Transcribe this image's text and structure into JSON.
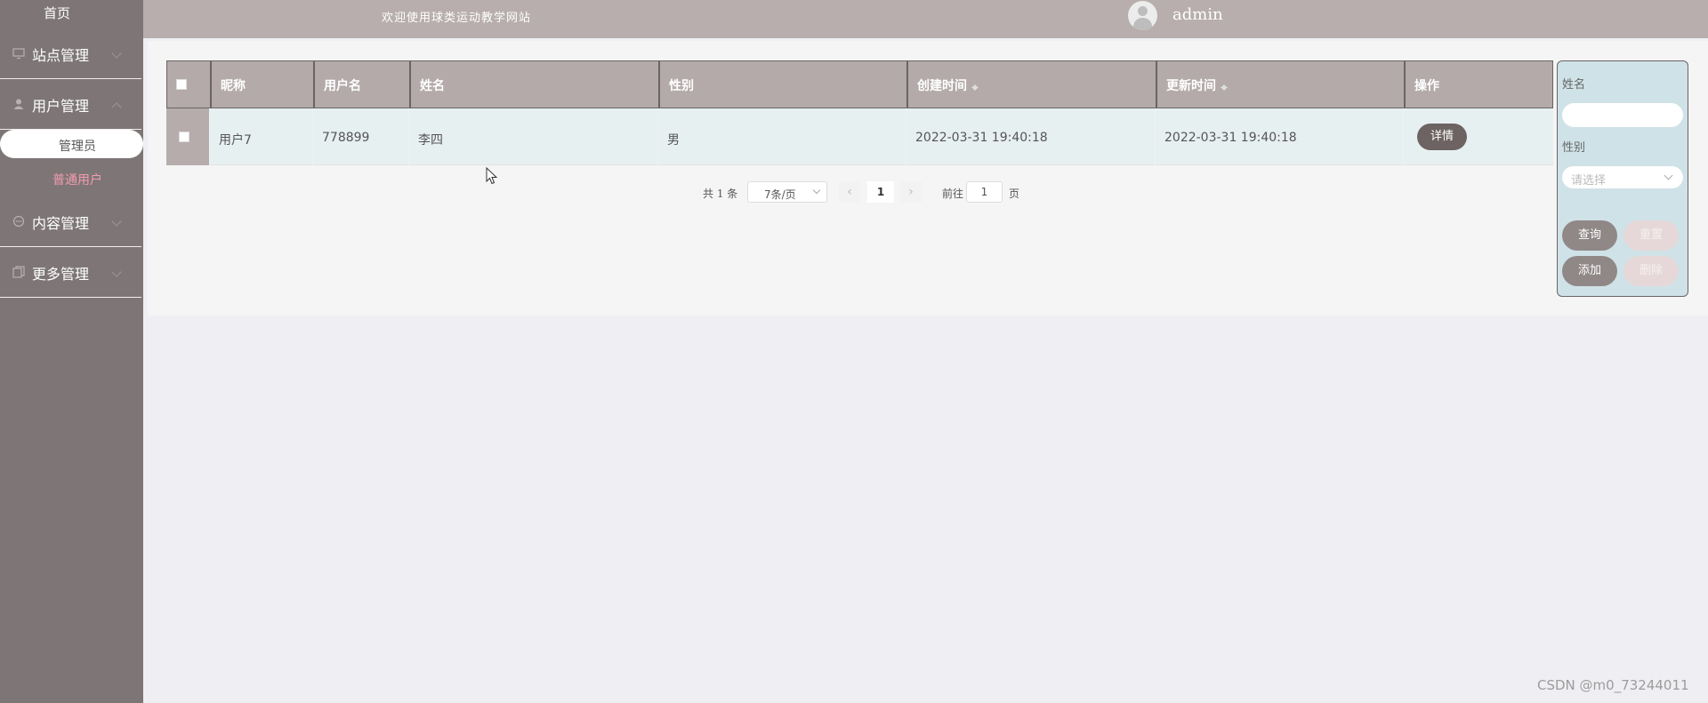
{
  "sidebar": {
    "home": "首页",
    "groups": [
      {
        "label": "站点管理",
        "icon": "monitor-icon"
      },
      {
        "label": "用户管理",
        "icon": "user-icon"
      },
      {
        "label": "内容管理",
        "icon": "chat-icon"
      },
      {
        "label": "更多管理",
        "icon": "copy-icon"
      }
    ],
    "sub_items": [
      {
        "label": "管理员",
        "active": true
      },
      {
        "label": "普通用户",
        "active": false
      }
    ]
  },
  "header": {
    "welcome": "欢迎使用球类运动教学网站",
    "username": "admin"
  },
  "table": {
    "columns": [
      "昵称",
      "用户名",
      "姓名",
      "性别",
      "创建时间",
      "更新时间",
      "操作"
    ],
    "rows": [
      {
        "nickname": "用户7",
        "username": "778899",
        "name": "李四",
        "gender": "男",
        "created": "2022-03-31 19:40:18",
        "updated": "2022-03-31 19:40:18",
        "action": "详情"
      }
    ]
  },
  "pagination": {
    "total": "共 1 条",
    "page_size": "7条/页",
    "prev": "‹",
    "current": "1",
    "next": "›",
    "goto_label": "前往",
    "goto_value": "1",
    "page_word": "页"
  },
  "search": {
    "name_label": "姓名",
    "name_value": "",
    "gender_label": "性别",
    "gender_placeholder": "请选择",
    "query": "查询",
    "reset": "重置",
    "add": "添加",
    "delete": "删除"
  },
  "watermark": "CSDN @m0_73244011",
  "colors": {
    "sidebar_bg": "#7e7676",
    "header_bg": "#b8aeae",
    "table_header_bg": "#b4aaaa",
    "row_bg": "#e7f0f1",
    "search_panel_bg": "#cfe2e7",
    "active_sub_text": "#f29bb0"
  }
}
